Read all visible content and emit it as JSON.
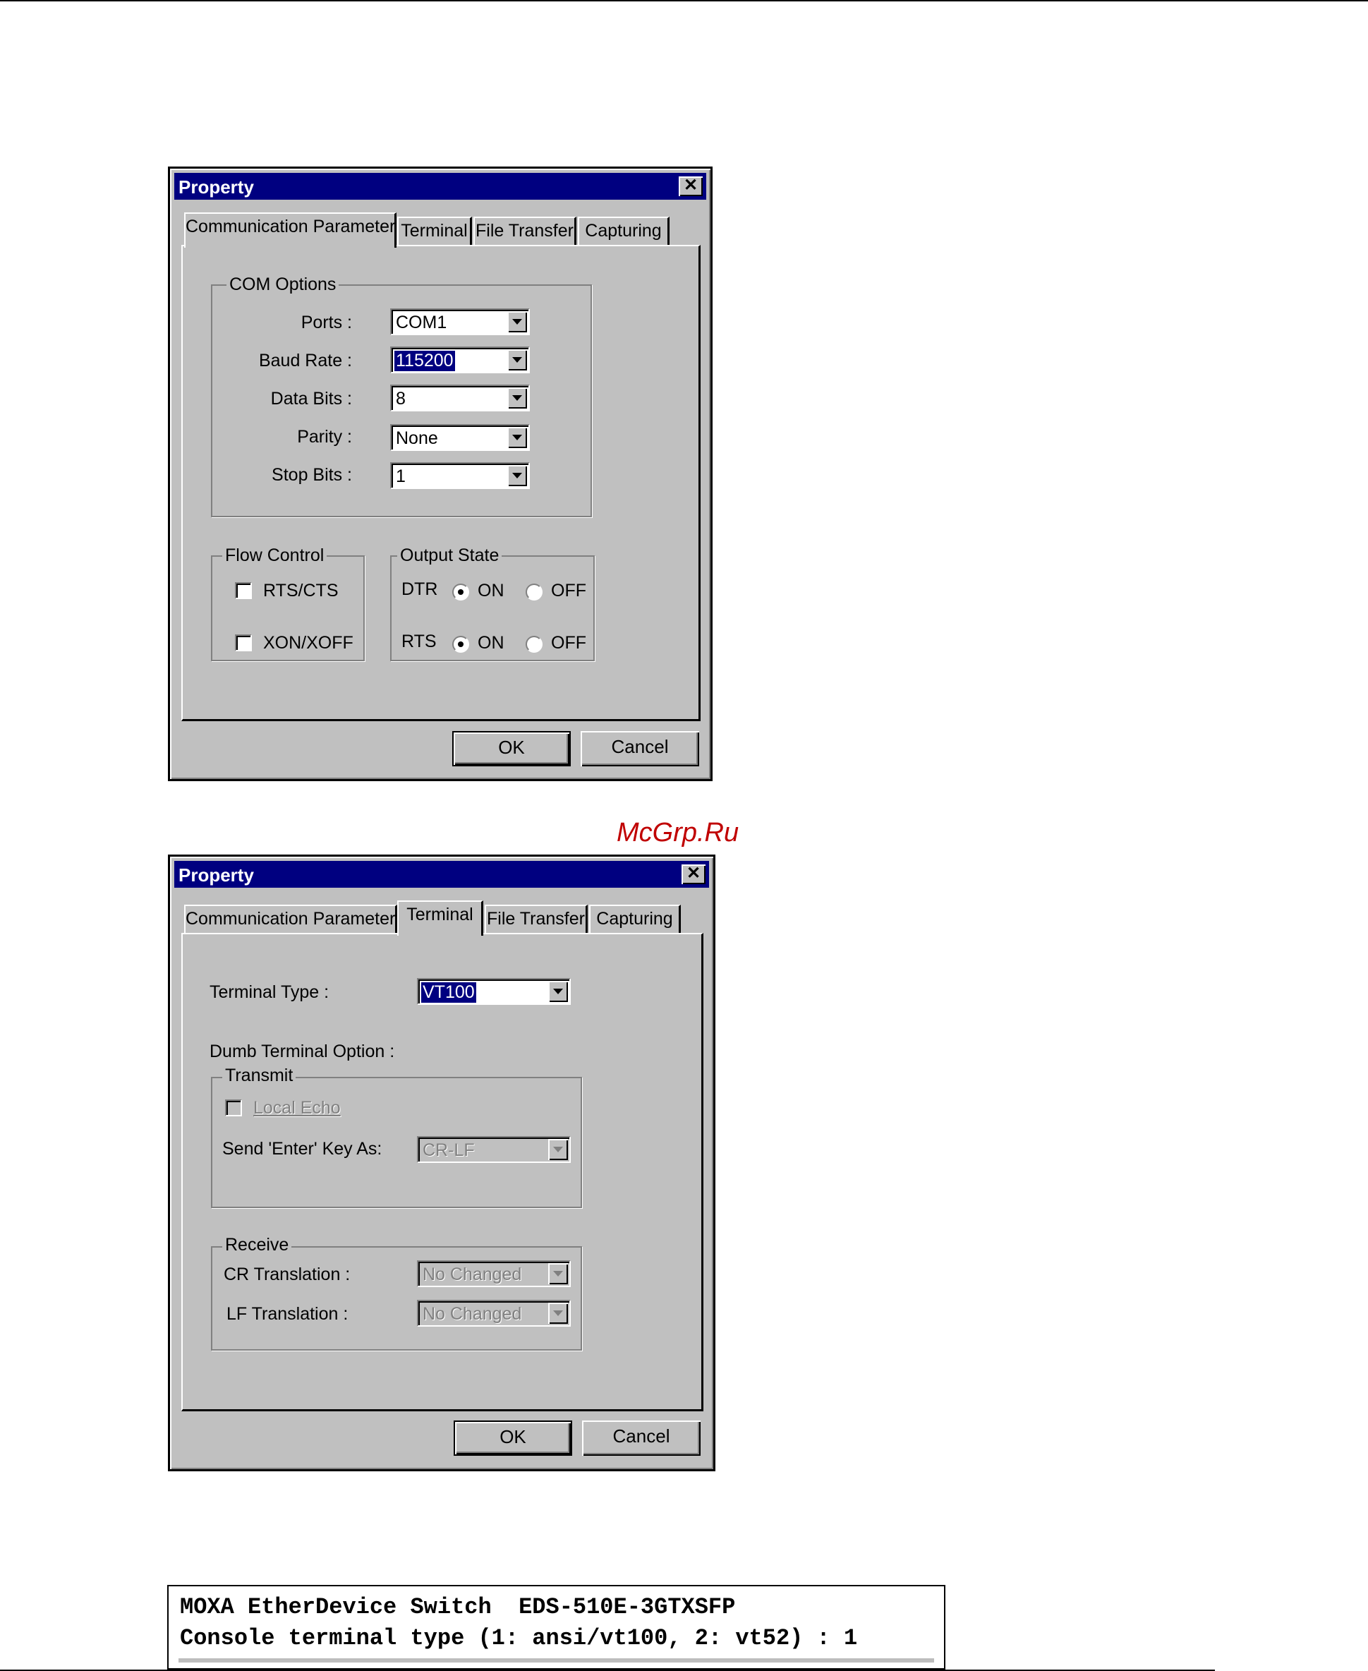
{
  "dialog1": {
    "title": "Property",
    "close": "✕",
    "tabs": [
      "Communication Parameter",
      "Terminal",
      "File Transfer",
      "Capturing"
    ],
    "com_options": {
      "legend": "COM Options",
      "ports_label": "Ports :",
      "ports_value": "COM1",
      "baud_label": "Baud Rate :",
      "baud_value": "115200",
      "data_bits_label": "Data Bits :",
      "data_bits_value": "8",
      "parity_label": "Parity :",
      "parity_value": "None",
      "stop_bits_label": "Stop Bits :",
      "stop_bits_value": "1"
    },
    "flow_control": {
      "legend": "Flow Control",
      "rts_cts": "RTS/CTS",
      "xon_xoff": "XON/XOFF"
    },
    "output_state": {
      "legend": "Output State",
      "dtr": "DTR",
      "rts": "RTS",
      "on": "ON",
      "off": "OFF"
    },
    "ok": "OK",
    "cancel": "Cancel"
  },
  "watermark": "McGrp.Ru",
  "dialog2": {
    "title": "Property",
    "close": "✕",
    "tabs": [
      "Communication Parameter",
      "Terminal",
      "File Transfer",
      "Capturing"
    ],
    "terminal_type_label": "Terminal Type :",
    "terminal_type_value": "VT100",
    "dumb_option_label": "Dumb Terminal Option :",
    "transmit": {
      "legend": "Transmit",
      "local_echo": "Local Echo",
      "send_enter_label": "Send 'Enter' Key  As:",
      "send_enter_value": "CR-LF"
    },
    "receive": {
      "legend": "Receive",
      "cr_label": "CR Translation :",
      "cr_value": "No Changed",
      "lf_label": "LF Translation :",
      "lf_value": "No Changed"
    },
    "ok": "OK",
    "cancel": "Cancel"
  },
  "console": {
    "line1": "MOXA EtherDevice Switch  EDS-510E-3GTXSFP",
    "line2": "Console terminal type (1: ansi/vt100, 2: vt52) : 1"
  }
}
